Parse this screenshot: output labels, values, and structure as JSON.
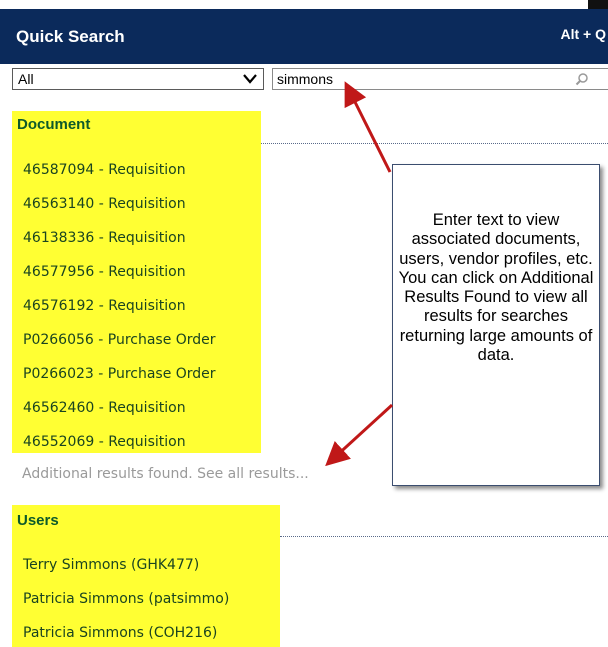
{
  "header": {
    "title": "Quick Search",
    "shortcut": "Alt + Q"
  },
  "controls": {
    "filter_value": "All",
    "search_value": "simmons"
  },
  "document_section": {
    "title": "Document",
    "items": [
      "46587094 - Requisition",
      "46563140 - Requisition",
      "46138336 - Requisition",
      "46577956 - Requisition",
      "46576192 - Requisition",
      "P0266056 - Purchase Order",
      "P0266023 - Purchase Order",
      "46562460 - Requisition",
      "46552069 - Requisition"
    ],
    "more_link": "Additional results found. See all results..."
  },
  "users_section": {
    "title": "Users",
    "items": [
      "Terry Simmons (GHK477)",
      "Patricia Simmons (patsimmo)",
      "Patricia Simmons (COH216)"
    ]
  },
  "callout": {
    "text": "Enter text to view associated documents, users, vendor profiles, etc. You can click on Additional Results Found to view all results for searches returning large amounts of data."
  },
  "colors": {
    "header_bg": "#0b2a5b",
    "highlight": "#ffff33",
    "section_text": "#0d5a2a",
    "arrow": "#c01818"
  }
}
